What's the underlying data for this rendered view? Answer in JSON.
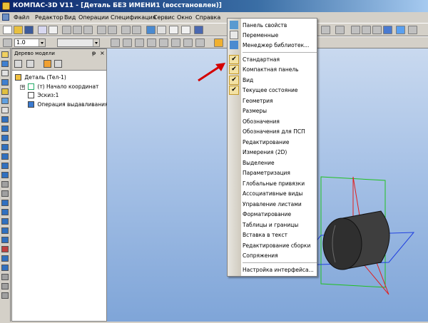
{
  "window": {
    "title": "КОМПАС-3D V11 - [Деталь БЕЗ ИМЕНИ1 (восстановлен)]"
  },
  "menubar": {
    "items": [
      "Файл",
      "Редактор",
      "Вид",
      "Операции",
      "Спецификация",
      "Сервис",
      "Окно",
      "Справка"
    ]
  },
  "toolbar": {
    "line_width_value": "1.0"
  },
  "tree": {
    "title": "Дерево модели",
    "pin_glyph": "ᵽ",
    "close_glyph": "×",
    "items": [
      {
        "label": "Деталь (Тел-1)"
      },
      {
        "label": "(т) Начало координат"
      },
      {
        "label": "Эскиз:1"
      },
      {
        "label": "Операция выдавливания:"
      }
    ]
  },
  "context_menu": {
    "items": [
      {
        "label": "Панель свойств",
        "checked": false,
        "icon": "properties-panel-icon"
      },
      {
        "label": "Переменные",
        "checked": false,
        "icon": "variables-fx-icon"
      },
      {
        "label": "Менеджер библиотек...",
        "checked": false,
        "icon": "library-manager-icon"
      },
      {
        "label": "Стандартная",
        "checked": true
      },
      {
        "label": "Компактная панель",
        "checked": true
      },
      {
        "label": "Вид",
        "checked": true
      },
      {
        "label": "Текущее состояние",
        "checked": true
      },
      {
        "label": "Геометрия",
        "checked": false
      },
      {
        "label": "Размеры",
        "checked": false
      },
      {
        "label": "Обозначения",
        "checked": false
      },
      {
        "label": "Обозначения для ПСП",
        "checked": false
      },
      {
        "label": "Редактирование",
        "checked": false
      },
      {
        "label": "Измерения (2D)",
        "checked": false
      },
      {
        "label": "Выделение",
        "checked": false
      },
      {
        "label": "Параметризация",
        "checked": false
      },
      {
        "label": "Глобальные привязки",
        "checked": false
      },
      {
        "label": "Ассоциативные виды",
        "checked": false
      },
      {
        "label": "Управление листами",
        "checked": false
      },
      {
        "label": "Форматирование",
        "checked": false
      },
      {
        "label": "Таблицы и границы",
        "checked": false
      },
      {
        "label": "Вставка в текст",
        "checked": false
      },
      {
        "label": "Редактирование сборки",
        "checked": false
      },
      {
        "label": "Сопряжения",
        "checked": false
      },
      {
        "label": "Настройка интерфейса...",
        "checked": false
      }
    ],
    "check_glyph": "✔"
  },
  "colors": {
    "annotation_red": "#d40000",
    "titlebar_blue": "#0a246a",
    "canvas_blue": "#a6c1e6",
    "cylinder_gray": "#3b3b3b"
  }
}
